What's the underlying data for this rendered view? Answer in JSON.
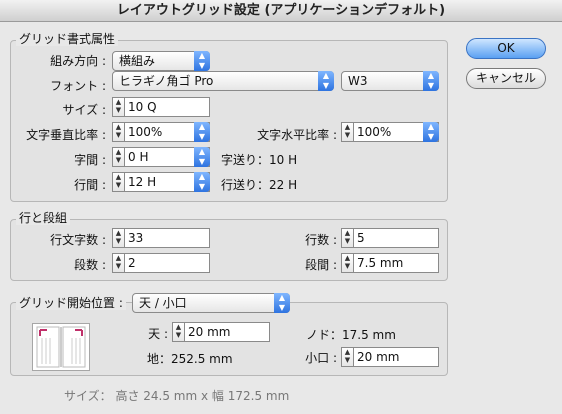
{
  "window": {
    "title": "レイアウトグリッド設定 (アプリケーションデフォルト)"
  },
  "grid_format": {
    "legend": "グリッド書式属性",
    "direction_label": "組み方向 :",
    "direction_value": "横組み",
    "font_label": "フォント :",
    "font_family_value": "ヒラギノ角ゴ Pro",
    "font_weight_value": "W3",
    "size_label": "サイズ :",
    "size_value": "10 Q",
    "vert_scale_label": "文字垂直比率 :",
    "vert_scale_value": "100%",
    "horiz_scale_label": "文字水平比率 :",
    "horiz_scale_value": "100%",
    "char_space_label": "字間 :",
    "char_space_value": "0 H",
    "char_aki_text": "字送り：10 H",
    "line_space_label": "行間 :",
    "line_space_value": "12 H",
    "line_aki_text": "行送り：22 H"
  },
  "lines_columns": {
    "legend": "行と段組",
    "chars_per_line_label": "行文字数 :",
    "chars_per_line_value": "33",
    "lines_label": "行数 :",
    "lines_value": "5",
    "columns_label": "段数 :",
    "columns_value": "2",
    "gutter_label": "段間 :",
    "gutter_value": "7.5 mm"
  },
  "grid_start": {
    "label": "グリッド開始位置 :",
    "value": "天 / 小口",
    "top_label": "天 :",
    "top_value": "20 mm",
    "nodo_text": "ノド：17.5 mm",
    "bottom_text": "地：252.5 mm",
    "koguchi_label": "小口 :",
    "koguchi_value": "20 mm"
  },
  "size_text": "サイズ： 高さ 24.5 mm x 幅 172.5 mm",
  "buttons": {
    "ok": "OK",
    "cancel": "キャンセル"
  },
  "colors": {
    "accent": "#3a73c4",
    "margin_mark": "#c0306a"
  }
}
